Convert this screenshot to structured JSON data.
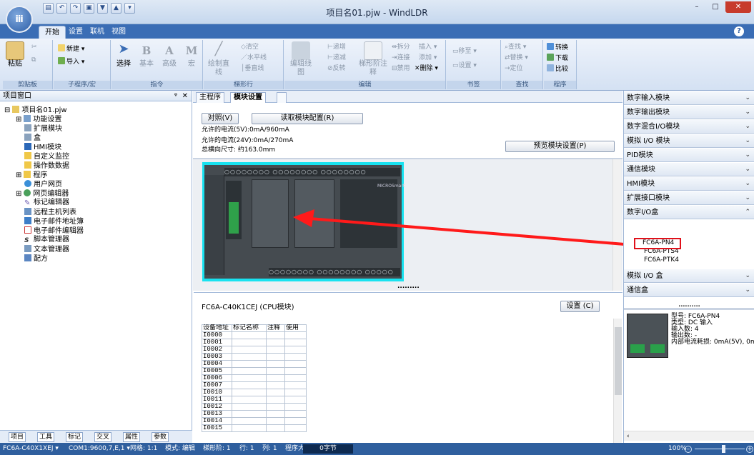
{
  "window": {
    "title": "项目名01.pjw - WindLDR"
  },
  "ribbon_tabs": [
    "开始",
    "设置",
    "联机",
    "视图"
  ],
  "ribbon": {
    "groups": [
      "剪贴板",
      "子程序/宏",
      "指令",
      "梯形行",
      "编辑",
      "书签",
      "查找",
      "程序"
    ],
    "paste": "粘贴",
    "new": "新建",
    "import": "导入",
    "select": "选择",
    "basic": "基本",
    "advanced": "高级",
    "macro": "宏",
    "draw_line": "绘制直线",
    "clear": "清空",
    "hline": "水平线",
    "vline": "垂直线",
    "edit_linegraph": "编辑线图",
    "insert": "递增",
    "delete_row": "递减",
    "reverse": "反转",
    "ladder_comment": "梯形阶注释",
    "split": "拆分",
    "connect": "连接",
    "disable": "禁用",
    "insert2": "插入",
    "add": "添加",
    "delete": "删除",
    "goto": "移至",
    "set": "设置",
    "find": "查找",
    "replace": "替换",
    "locate": "定位",
    "convert": "转换",
    "download": "下载",
    "compare": "比较"
  },
  "project_window": {
    "title": "项目窗口",
    "tree": [
      "项目名01.pjw",
      "功能设置",
      "扩展模块",
      "盒",
      "HMI模块",
      "自定义监控",
      "操作数数据",
      "程序",
      "用户网页",
      "网页编辑器",
      "标记编辑器",
      "远程主机列表",
      "电子邮件地址簿",
      "电子邮件编辑器",
      "脚本管理器",
      "文本管理器",
      "配方"
    ],
    "tabs": [
      "项目",
      "工具",
      "标记",
      "交叉",
      "属性",
      "参数"
    ]
  },
  "doc_tabs": [
    "主程序",
    "模块设置"
  ],
  "module_config": {
    "compare_btn": "对照(V)",
    "read_btn": "读取模块配置(R)",
    "current_5v": "允许的电流(5V):0mA/960mA",
    "current_24v": "允许的电流(24V):0mA/270mA",
    "total_width": "总横向尺寸: 约163.0mm",
    "preview_btn": "预览模块设置(P)",
    "plc_brand": "MICROSmart",
    "cpu_label": "FC6A-C40K1CEJ (CPU模块)",
    "settings_btn": "设置 (C)"
  },
  "tag_table": {
    "headers": [
      "设备地址",
      "标记名称",
      "注释",
      "使用"
    ],
    "rows": [
      "I0000",
      "I0001",
      "I0002",
      "I0003",
      "I0004",
      "I0005",
      "I0006",
      "I0007",
      "I0010",
      "I0011",
      "I0012",
      "I0013",
      "I0014",
      "I0015"
    ]
  },
  "module_list": {
    "categories": [
      "数字输入模块",
      "数字输出模块",
      "数字混合I/O模块",
      "模拟 I/O 模块",
      "PID模块",
      "通信模块",
      "HMI模块",
      "扩展接口模块",
      "数字I/O盒"
    ],
    "expanded_items": [
      "FC6A-PN4",
      "FC6A-PTS4",
      "FC6A-PTK4"
    ],
    "lower_categories": [
      "模拟 I/O 盒",
      "通信盒"
    ],
    "detail": {
      "model": "型号: FC6A-PN4",
      "type": "类型: DC 输入",
      "inputs": "输入数: 4",
      "outputs": "输出数: -",
      "current": "内部电流耗损: 0mA(5V), 0m"
    }
  },
  "status": {
    "cpu": "FC6A-C40X1XEJ",
    "com": "COM1:9600,7,E,1",
    "grid": "网格: 1:1",
    "mode": "模式: 编辑",
    "ladder": "梯形阶: 1",
    "row": "行: 1",
    "col": "列: 1",
    "size_label": "程序大小:",
    "size_value": "0字节",
    "zoom": "100%"
  },
  "colors": {
    "accent": "#2f5f9e",
    "highlight": "#ff0000",
    "plc_frame": "#18e2f0"
  }
}
